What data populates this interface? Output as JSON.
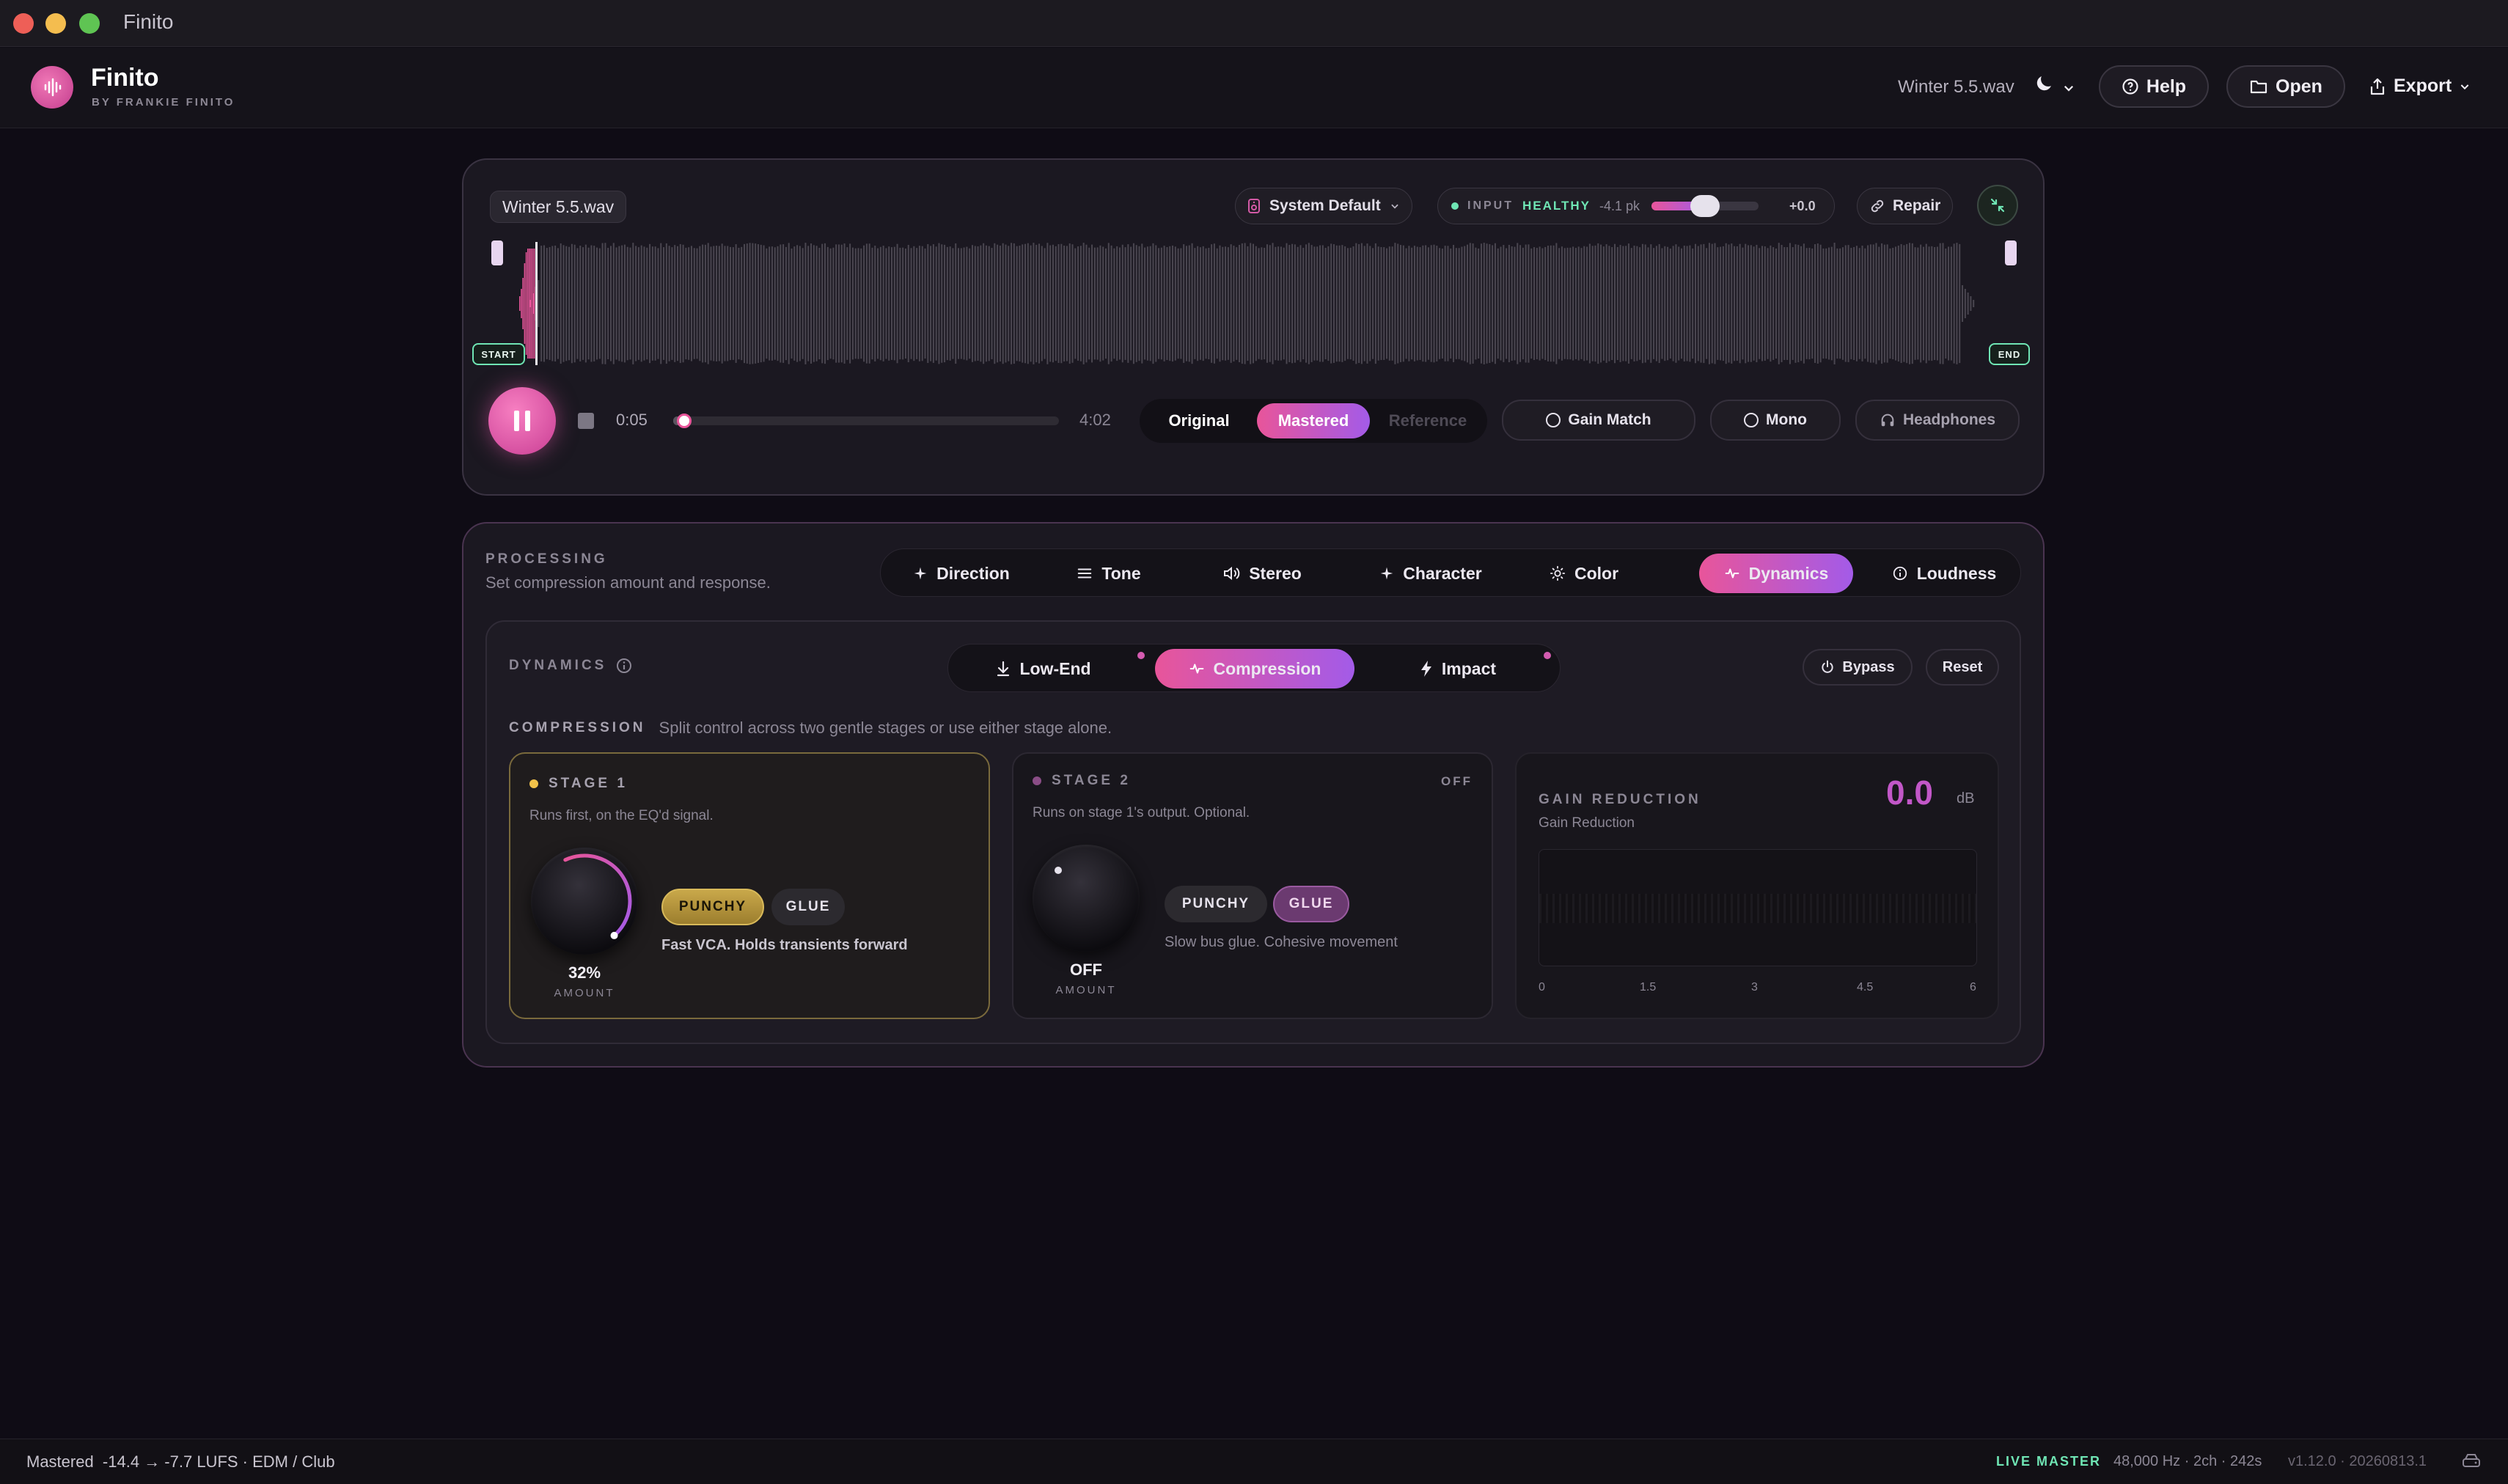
{
  "window": {
    "title": "Finito"
  },
  "header": {
    "brand": "Finito",
    "brand_sub": "BY FRANKIE FINITO",
    "file_name": "Winter 5.5.wav",
    "help_label": "Help",
    "open_label": "Open",
    "export_label": "Export"
  },
  "player": {
    "file_chip": "Winter 5.5.wav",
    "output_device": "System Default",
    "input_label": "INPUT",
    "input_status": "HEALTHY",
    "input_peak": "-4.1 pk",
    "input_gain": "+0.0",
    "input_gain_level": 0.5,
    "repair_label": "Repair",
    "start_label": "START",
    "end_label": "END",
    "current_time": "0:05",
    "total_time": "4:02",
    "progress": 0.02,
    "compare_modes": [
      "Original",
      "Mastered",
      "Reference"
    ],
    "selected_mode": "Mastered",
    "gain_match_label": "Gain Match",
    "mono_label": "Mono",
    "headphones_label": "Headphones"
  },
  "processing": {
    "section_label": "PROCESSING",
    "description": "Set compression amount and response.",
    "tabs": [
      "Direction",
      "Tone",
      "Stereo",
      "Character",
      "Color",
      "Dynamics",
      "Loudness"
    ],
    "active_tab": "Dynamics"
  },
  "dynamics": {
    "label": "DYNAMICS",
    "subtabs": [
      "Low-End",
      "Compression",
      "Impact"
    ],
    "active_subtab": "Compression",
    "bypass_label": "Bypass",
    "reset_label": "Reset",
    "compression_label": "COMPRESSION",
    "compression_description": "Split control across two gentle stages or use either stage alone.",
    "stage1": {
      "title": "STAGE 1",
      "description": "Runs first, on the EQ'd signal.",
      "amount_value": "32%",
      "amount_fraction": 0.32,
      "amount_label": "AMOUNT",
      "modes": [
        "PUNCHY",
        "GLUE"
      ],
      "selected_mode": "PUNCHY",
      "mode_description": "Fast VCA. Holds transients forward"
    },
    "stage2": {
      "title": "STAGE 2",
      "status": "OFF",
      "description": "Runs on stage 1's output. Optional.",
      "amount_value": "OFF",
      "amount_label": "AMOUNT",
      "modes": [
        "PUNCHY",
        "GLUE"
      ],
      "selected_mode": "GLUE",
      "mode_description": "Slow bus glue. Cohesive movement"
    },
    "gain_reduction": {
      "title": "GAIN REDUCTION",
      "subtitle": "Gain Reduction",
      "value": "0.0",
      "unit": "dB",
      "scale": [
        "0",
        "1.5",
        "3",
        "4.5",
        "6"
      ]
    }
  },
  "status_bar": {
    "left": "Mastered  -14.4 → -7.7 LUFS · EDM / Club",
    "live": "LIVE MASTER",
    "info": "48,000 Hz · 2ch · 242s",
    "version": "v1.12.0 · 20260813.1"
  },
  "colors": {
    "accent_pink": "#e8559a",
    "accent_purple": "#a35be8",
    "healthy_green": "#6fe5b4",
    "punchy_gold": "#b8993d"
  }
}
